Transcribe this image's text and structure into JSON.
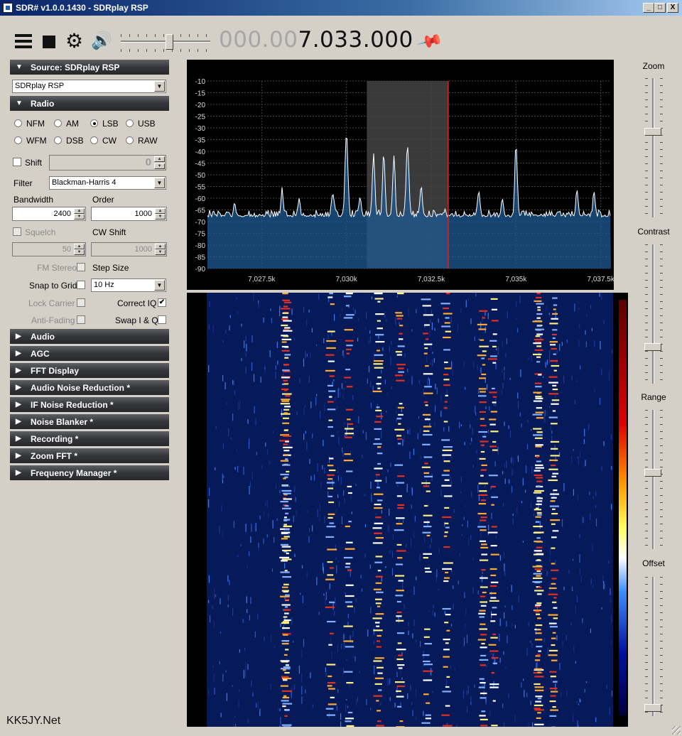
{
  "window": {
    "title": "SDR# v1.0.0.1430 - SDRplay RSP",
    "min": "_",
    "max": "□",
    "close": "X"
  },
  "toolbar": {
    "freq_dim": "000.00",
    "freq_bright": "7.033.000",
    "volume_level": 0.55
  },
  "source": {
    "header": "Source: SDRplay RSP",
    "device": "SDRplay RSP"
  },
  "radio": {
    "header": "Radio",
    "modes_row1": [
      "NFM",
      "AM",
      "LSB",
      "USB"
    ],
    "modes_row2": [
      "WFM",
      "DSB",
      "CW",
      "RAW"
    ],
    "selected": "LSB",
    "shift_label": "Shift",
    "shift_value": "0",
    "filter_label": "Filter",
    "filter_value": "Blackman-Harris 4",
    "bandwidth_label": "Bandwidth",
    "bandwidth_value": "2400",
    "order_label": "Order",
    "order_value": "1000",
    "squelch_label": "Squelch",
    "squelch_value": "50",
    "cwshift_label": "CW Shift",
    "cwshift_value": "1000",
    "fmstereo_label": "FM Stereo",
    "stepsize_label": "Step Size",
    "snap_label": "Snap to Grid",
    "step_value": "10 Hz",
    "lockcarrier_label": "Lock Carrier",
    "correctiq_label": "Correct IQ",
    "correctiq_mark": "✔",
    "antifading_label": "Anti-Fading",
    "swapiq_label": "Swap I & Q"
  },
  "panels": [
    "Audio",
    "AGC",
    "FFT Display",
    "Audio Noise Reduction *",
    "IF Noise Reduction *",
    "Noise Blanker *",
    "Recording *",
    "Zoom FFT *",
    "Frequency Manager *"
  ],
  "arrows": {
    "open": "▼",
    "closed": "▶"
  },
  "sliders": {
    "zoom": {
      "label": "Zoom",
      "level": 0.62
    },
    "contrast": {
      "label": "Contrast",
      "level": 0.25
    },
    "range": {
      "label": "Range",
      "level": 0.55
    },
    "offset": {
      "label": "Offset",
      "level": 0.03
    }
  },
  "spectrum": {
    "y_ticks": [
      "-10",
      "-15",
      "-20",
      "-25",
      "-30",
      "-35",
      "-40",
      "-45",
      "-50",
      "-55",
      "-60",
      "-65",
      "-70",
      "-75",
      "-80",
      "-85",
      "-90"
    ],
    "x_ticks": [
      "7,027.5k",
      "7,030k",
      "7,032.5k",
      "7,035k",
      "7,037.5k"
    ],
    "passband_khz": [
      7030.6,
      7033.0
    ],
    "center_khz": 7033.0
  },
  "watermark": "KK5JY.Net"
}
